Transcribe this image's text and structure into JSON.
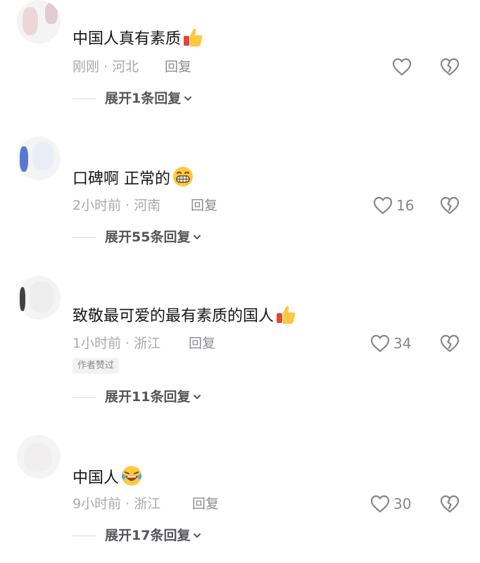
{
  "comments": [
    {
      "username": "",
      "text": "中国人真有素质",
      "emoji": "thumbs-up-emoji",
      "time": "刚刚",
      "location": "河北",
      "reply_label": "回复",
      "likes": "",
      "badge": "",
      "expand_label": "展开1条回复"
    },
    {
      "username": "",
      "text": "口碑啊 正常的",
      "emoji": "grinning-face-emoji",
      "time": "2小时前",
      "location": "河南",
      "reply_label": "回复",
      "likes": "16",
      "badge": "",
      "expand_label": "展开55条回复"
    },
    {
      "username": "",
      "text": "致敬最可爱的最有素质的国人",
      "emoji": "thumbs-up-emoji",
      "time": "1小时前",
      "location": "浙江",
      "reply_label": "回复",
      "likes": "34",
      "badge": "作者赞过",
      "expand_label": "展开11条回复"
    },
    {
      "username": "",
      "text": "中国人",
      "emoji": "crying-laughing-emoji",
      "time": "9小时前",
      "location": "浙江",
      "reply_label": "回复",
      "likes": "30",
      "badge": "",
      "expand_label": "展开17条回复"
    }
  ],
  "meta_separator": " · ",
  "colors": {
    "text": "#161616",
    "meta": "#a9a9ad",
    "icon": "#86868a",
    "badge_bg": "#f2f2f2"
  }
}
